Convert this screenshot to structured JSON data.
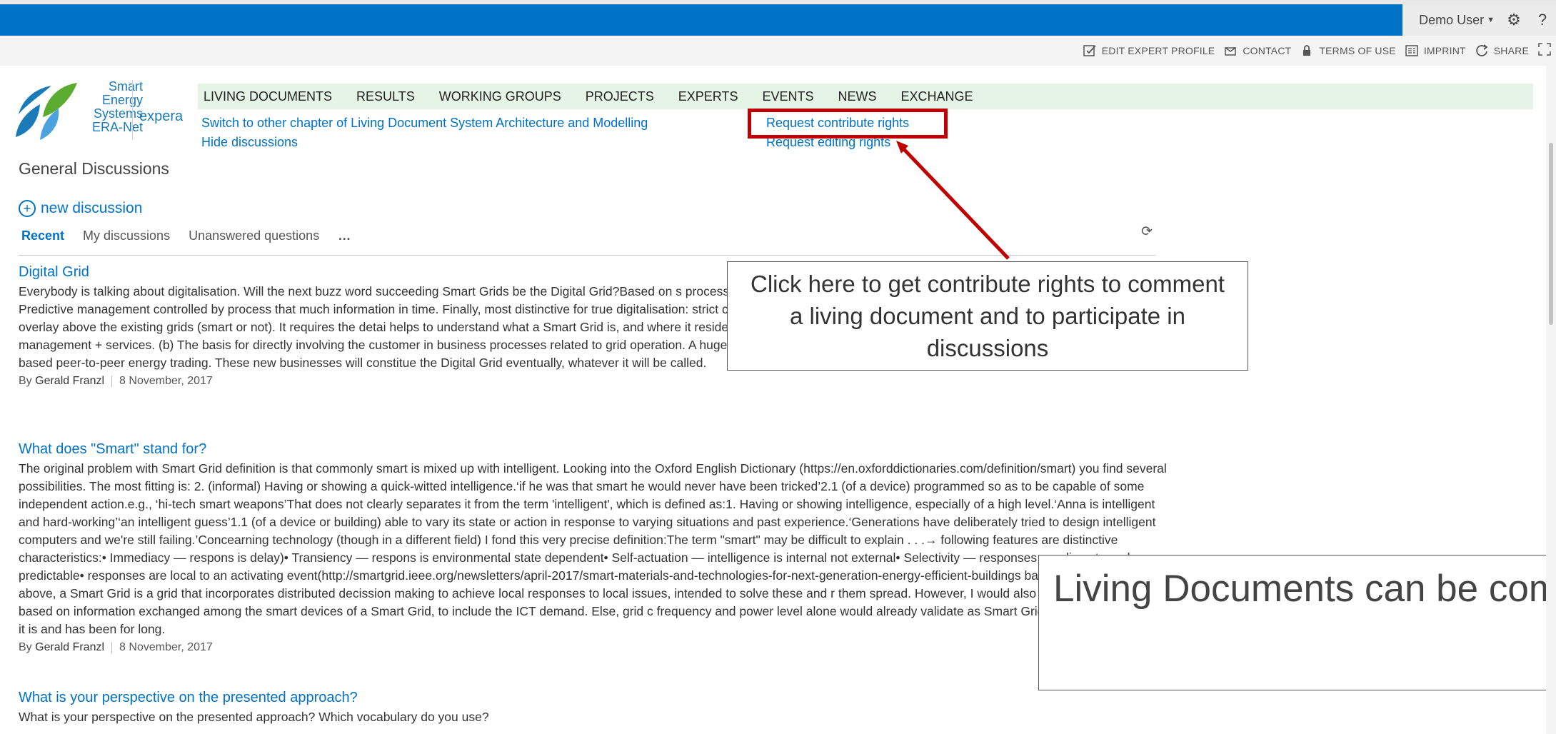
{
  "suite_bar": {
    "user_name": "Demo User",
    "icons": [
      "gear-icon",
      "help-icon"
    ],
    "help_glyph": "?"
  },
  "ribbon_links": [
    {
      "label": "EDIT EXPERT PROFILE",
      "icon": "edit-profile-icon"
    },
    {
      "label": "CONTACT",
      "icon": "contact-icon"
    },
    {
      "label": "TERMS OF USE",
      "icon": "lock-icon"
    },
    {
      "label": "IMPRINT",
      "icon": "imprint-icon"
    },
    {
      "label": "SHARE",
      "icon": "share-icon"
    }
  ],
  "logo": {
    "line1": "Smart",
    "line2": "Energy",
    "line3": "Systems",
    "line4": "ERA-Net",
    "suffix": "expera"
  },
  "nav": [
    "LIVING DOCUMENTS",
    "RESULTS",
    "WORKING GROUPS",
    "PROJECTS",
    "EXPERTS",
    "EVENTS",
    "NEWS",
    "EXCHANGE"
  ],
  "links": {
    "switch_chapter": "Switch to other chapter of Living Document System Architecture and Modelling",
    "hide_discussions": "Hide discussions",
    "request_contribute": "Request contribute rights",
    "request_editing": "Request editing rights"
  },
  "discussions": {
    "title": "General Discussions",
    "new_label": "new discussion",
    "tabs": [
      "Recent",
      "My discussions",
      "Unanswered questions"
    ],
    "more": "…"
  },
  "posts": [
    {
      "title": "Digital Grid",
      "body": "Everybody is talking about digitalisation. Will the next buzz word succeeding Smart Grids be the Digital Grid?Based on s processes and new services based on the digital twin of the grid, all realised by IT. Predictive management controlled by process that much information in time. Finally, most distinctive for true digitalisation: strict customer oriention. Utilities a Batteries (e-on).Now, the Digital Grid is definitely an overlay above the existing grids (smart or not). It requires the detai helps to understand what a Smart Grid is, and where it resides in the hierarchy. To me the Smart Grid appears to be som communication + management + services. (b) The basis for directly involving the customer in business processes related to grid operation. A huge opportunity for new business in totally new ways not seen, e.g., BlockChain based peer-to-peer energy trading. These new businesses will constitue the Digital Grid eventually, whatever it will be called.",
      "by": "By",
      "author": "Gerald Franzl",
      "date": "8 November, 2017"
    },
    {
      "title": "What does \"Smart\" stand for?",
      "body": "The original problem with Smart Grid definition is that commonly smart is mixed up with intelligent. Looking into the Oxford English Dictionary (https://en.oxforddictionaries.com/definition/smart) you find several possibilities. The most fitting is: 2. (informal) Having or showing a quick-witted intelligence.‘if he was that smart he would never have been tricked’2.1 (of a device) programmed so as to be capable of some independent action.e.g., ‘hi-tech smart weapons’That does not clearly separates it from the term 'intelligent', which is defined as:1. Having or showing intelligence, especially of a high level.‘Anna is intelligent and hard-working’‘an intelligent guess’1.1 (of a device or building) able to vary its state or action in response to varying situations and past experience.‘Generations have deliberately tried to design intelligent computers and we're still failing.’Concearning technology (though in a different field) I fond this very precise definition:The term \"smart\" may be difficult to explain . . .→ following features are distinctive characteristics:• Immediacy — respons is delay)• Transiency — respons is environmental state dependent• Self-actuation — intelligence is internal not external• Selectivity — responses are discrete and predictable• responses are local to an activating event(http://smartgrid.ieee.org/newsletters/april-2017/smart-materials-and-technologies-for-next-generation-energy-efficient-buildings based on the definitions above, a Smart Grid is a grid that incorporates distributed decission making to achieve local responses to local issues, intended to solve these and r them spread. However, I would also add cooperativeness based on information exchanged among the smart devices of a Smart Grid, to include the ICT demand. Else, grid c frequency and power level alone would already validate as Smart Grid because smart it is as it is and has been for long.",
      "by": "By",
      "author": "Gerald Franzl",
      "date": "8 November, 2017"
    },
    {
      "title": "What is your perspective on the presented approach?",
      "body": "What is your perspective on the presented approach? Which vocabulary do you use?"
    }
  ],
  "annotations": {
    "callout_contribute": "Click here to get  contribute rights to comment a living document and to participate in discussions",
    "callout_commented": "Living Documents can be commented by any platform"
  },
  "colors": {
    "brand_blue": "#0072c6",
    "nav_bg": "#e6f4e5",
    "annotation_red": "#c00000"
  }
}
